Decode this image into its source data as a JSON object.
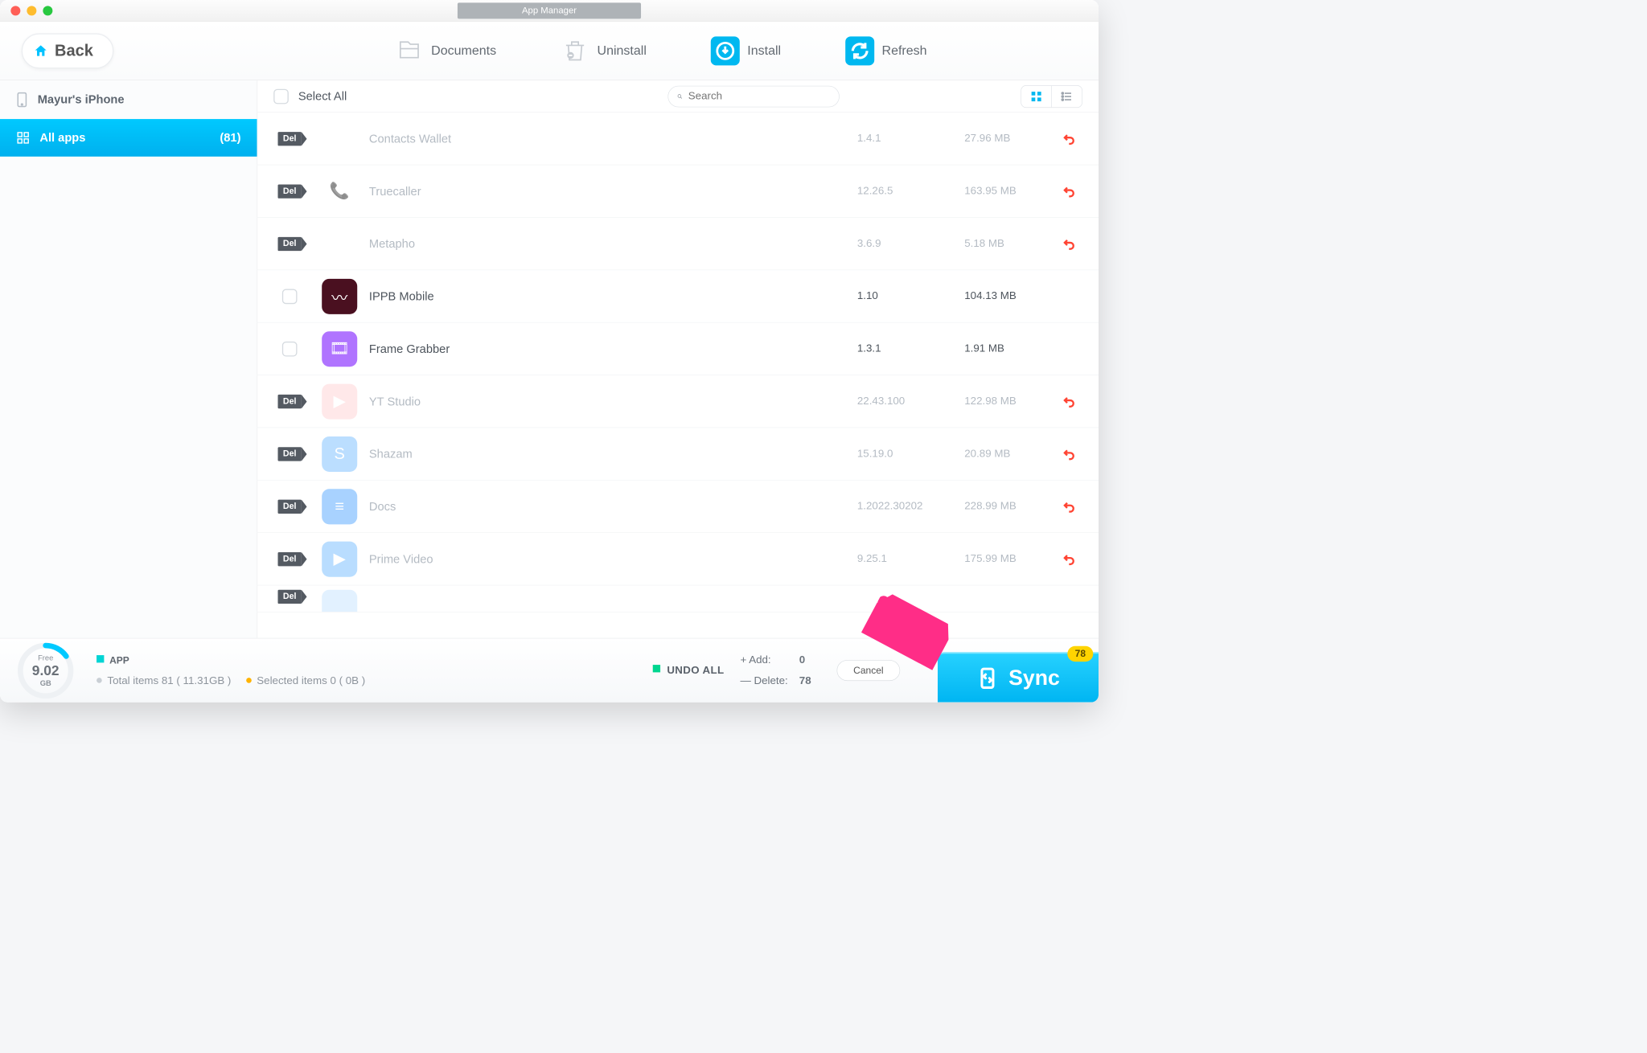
{
  "title": "App Manager",
  "back_label": "Back",
  "top_actions": {
    "documents": "Documents",
    "uninstall": "Uninstall",
    "install": "Install",
    "refresh": "Refresh"
  },
  "sidebar": {
    "device_name": "Mayur's iPhone",
    "category_label": "All apps",
    "category_count": "(81)"
  },
  "list_header": {
    "select_all": "Select All",
    "search_placeholder": "Search"
  },
  "apps": [
    {
      "marked_del": true,
      "name": "Contacts Wallet",
      "version": "1.4.1",
      "size": "27.96 MB",
      "undo": true,
      "icon_bg": "#fff",
      "icon_glyph": "•••"
    },
    {
      "marked_del": true,
      "name": "Truecaller",
      "version": "12.26.5",
      "size": "163.95 MB",
      "undo": true,
      "icon_bg": "#fff",
      "icon_glyph": "📞"
    },
    {
      "marked_del": true,
      "name": "Metapho",
      "version": "3.6.9",
      "size": "5.18 MB",
      "undo": true,
      "icon_bg": "#fff",
      "icon_glyph": "✳"
    },
    {
      "marked_del": false,
      "name": "IPPB Mobile",
      "version": "1.10",
      "size": "104.13 MB",
      "undo": false,
      "icon_bg": "#4a1020",
      "icon_glyph": "〰"
    },
    {
      "marked_del": false,
      "name": "Frame Grabber",
      "version": "1.3.1",
      "size": "1.91 MB",
      "undo": false,
      "icon_bg": "#b074ff",
      "icon_glyph": "🎞"
    },
    {
      "marked_del": true,
      "name": "YT Studio",
      "version": "22.43.100",
      "size": "122.98 MB",
      "undo": true,
      "icon_bg": "#ffd9dc",
      "icon_glyph": "▶"
    },
    {
      "marked_del": true,
      "name": "Shazam",
      "version": "15.19.0",
      "size": "20.89 MB",
      "undo": true,
      "icon_bg": "#8fc9ff",
      "icon_glyph": "S"
    },
    {
      "marked_del": true,
      "name": "Docs",
      "version": "1.2022.30202",
      "size": "228.99 MB",
      "undo": true,
      "icon_bg": "#6fb5ff",
      "icon_glyph": "≡"
    },
    {
      "marked_del": true,
      "name": "Prime Video",
      "version": "9.25.1",
      "size": "175.99 MB",
      "undo": true,
      "icon_bg": "#8cc8ff",
      "icon_glyph": "▶"
    }
  ],
  "footer": {
    "free_label": "Free",
    "free_value": "9.02",
    "free_unit": "GB",
    "app_label": "APP",
    "total_items": "Total items 81 ( 11.31GB )",
    "selected_items": "Selected items 0 ( 0B )",
    "undo_all": "UNDO ALL",
    "add_label": "+ Add:",
    "add_value": "0",
    "delete_label": "— Delete:",
    "delete_value": "78",
    "cancel": "Cancel",
    "sync": "Sync",
    "sync_badge": "78"
  },
  "del_badge_text": "Del"
}
